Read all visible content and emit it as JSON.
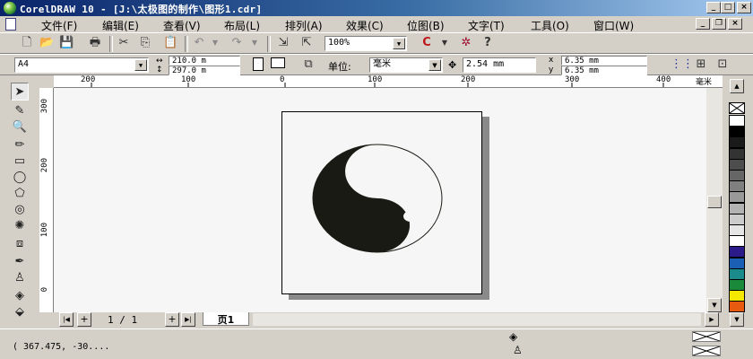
{
  "window": {
    "title": "CorelDRAW 10 - [J:\\太极图的制作\\图形1.cdr]"
  },
  "menu": [
    "文件(F)",
    "编辑(E)",
    "查看(V)",
    "布局(L)",
    "排列(A)",
    "效果(C)",
    "位图(B)",
    "文字(T)",
    "工具(O)",
    "窗口(W)"
  ],
  "toolbar": {
    "zoom": "100%"
  },
  "property_bar": {
    "paper_size": "A4",
    "width": "210.0 m",
    "height": "297.0 m",
    "unit_label": "单位:",
    "unit": "毫米",
    "nudge": "2.54 mm",
    "dup_x": "6.35 mm",
    "dup_y": "6.35 mm"
  },
  "ruler_top": [
    "200",
    "100",
    "0",
    "100",
    "200",
    "300",
    "400",
    "毫米"
  ],
  "ruler_left": [
    "300",
    "200",
    "100",
    "0"
  ],
  "page_nav": {
    "count": "1 / 1",
    "tab": "页1"
  },
  "status": {
    "coords": "( 367.475, -30...."
  },
  "palette": {
    "colors": [
      "#ffffff",
      "#000000",
      "#1a1a1a",
      "#333333",
      "#4d4d4d",
      "#666666",
      "#808080",
      "#999999",
      "#b3b3b3",
      "#cccccc",
      "#e6e6e6",
      "#ffffff",
      "#2b1a8a",
      "#1a5fb4",
      "#1a8a8a",
      "#1a8a3a",
      "#f5e800",
      "#e85a10"
    ]
  }
}
